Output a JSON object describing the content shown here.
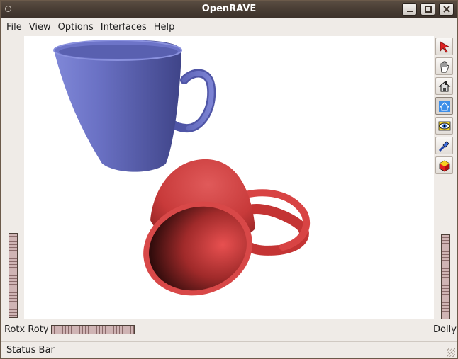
{
  "window": {
    "title": "OpenRAVE"
  },
  "menu": {
    "items": [
      "File",
      "View",
      "Options",
      "Interfaces",
      "Help"
    ]
  },
  "toolbar": {
    "tools": [
      "select-arrow-icon",
      "hand-icon",
      "home-icon",
      "set-home-icon",
      "view-all-icon",
      "headlight-icon",
      "projection-icon"
    ]
  },
  "controls": {
    "rot_label": "Rotx Roty",
    "dolly_label": "Dolly"
  },
  "status": {
    "text": "Status Bar"
  },
  "colors": {
    "mug_blue": "#5c62b8",
    "mug_red": "#d94242",
    "titlebar": "#4a3e35"
  }
}
